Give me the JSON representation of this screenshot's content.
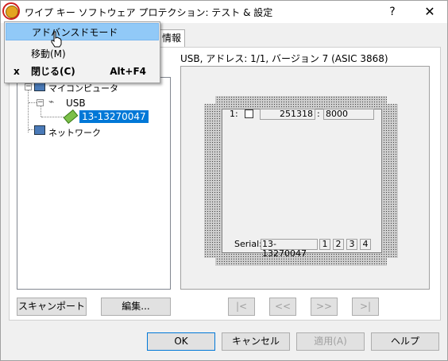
{
  "window": {
    "title": "ワイプ キー ソフトウェア プロテクション: テスト & 設定",
    "help_label": "?",
    "close_label": "✕",
    "icon": "app-key-icon"
  },
  "context_menu": {
    "items": [
      {
        "label": "アドバンスドモード",
        "highlighted": true
      },
      {
        "label": "移動(M)"
      },
      {
        "label": "閉じる(C)",
        "mark": "x",
        "accel": "Alt+F4"
      }
    ]
  },
  "tab": {
    "label": "情報"
  },
  "tree": {
    "root": "マイコンピュータ",
    "usb": "USB",
    "device": "13-13270047",
    "network": "ネットワーク"
  },
  "left_buttons": {
    "scan": "スキャンポート",
    "edit": "編集..."
  },
  "device_info": {
    "header": "USB, アドレス: 1/1, バージョン 7 (ASIC 3868)",
    "slot_index": "1:",
    "slot_value": "251318",
    "slot_sep": ":",
    "slot_value2": "8000",
    "serial_label": "Serial:",
    "serial_value": "13-13270047",
    "ports": [
      "1",
      "2",
      "3",
      "4"
    ]
  },
  "nav": {
    "first": "|<",
    "prev": "<<",
    "next": ">>",
    "last": ">|"
  },
  "footer": {
    "ok": "OK",
    "cancel": "キャンセル",
    "apply": "適用(A)",
    "help": "ヘルプ"
  }
}
